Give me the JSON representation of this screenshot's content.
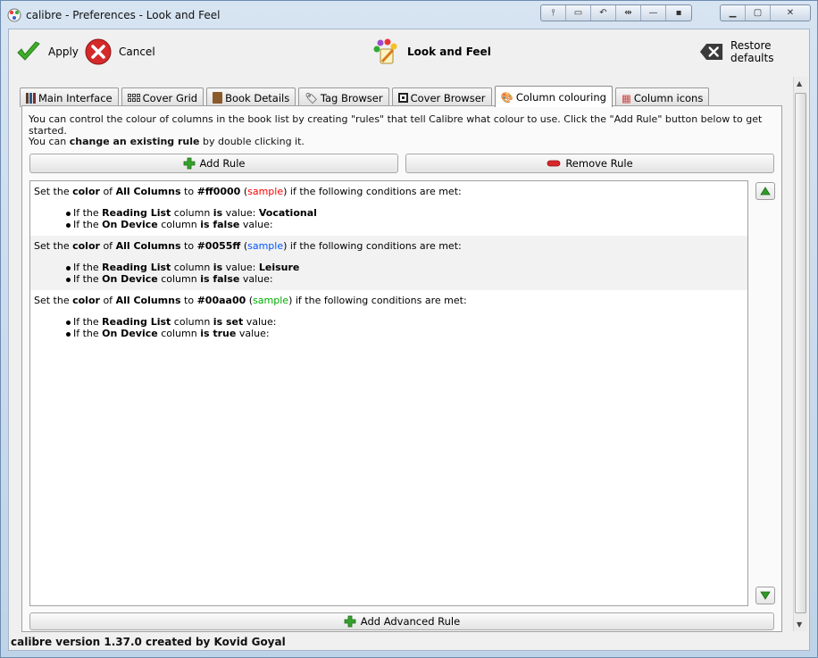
{
  "window": {
    "title": "calibre - Preferences - Look and Feel"
  },
  "toolbar": {
    "apply_label": "Apply",
    "cancel_label": "Cancel",
    "section_title": "Look and Feel",
    "restore_label": "Restore defaults"
  },
  "tabs": [
    {
      "label": "Main Interface",
      "icon": "books-icon"
    },
    {
      "label": "Cover Grid",
      "icon": "grid-icon"
    },
    {
      "label": "Book Details",
      "icon": "book-icon"
    },
    {
      "label": "Tag Browser",
      "icon": "tag-icon"
    },
    {
      "label": "Cover Browser",
      "icon": "cover-icon"
    },
    {
      "label": "Column colouring",
      "icon": "palette-icon",
      "active": true
    },
    {
      "label": "Column icons",
      "icon": "column-icons-icon"
    }
  ],
  "panel": {
    "intro_line1": "You can control the colour of columns in the book list by creating \"rules\" that tell Calibre what colour to use. Click the \"Add Rule\" button below to get started.",
    "intro_line2_prefix": "You can ",
    "intro_line2_bold": "change an existing rule",
    "intro_line2_suffix": " by double clicking it.",
    "add_rule_label": "Add Rule",
    "remove_rule_label": "Remove Rule",
    "add_advanced_label": "Add Advanced Rule"
  },
  "rules": [
    {
      "set": "Set the ",
      "color_word": "color",
      "of": " of ",
      "columns": "All Columns",
      "to": " to ",
      "value": "#ff0000",
      "sample": "sample",
      "sample_color": "#ff0000",
      "tail": " if the following conditions are met:",
      "conditions": [
        {
          "p1": "If the ",
          "col": "Reading List",
          "p2": " column ",
          "op": "is",
          "p3": " value: ",
          "val": "Vocational"
        },
        {
          "p1": "If the ",
          "col": "On Device",
          "p2": " column ",
          "op": "is false",
          "p3": " value:",
          "val": ""
        }
      ]
    },
    {
      "set": "Set the ",
      "color_word": "color",
      "of": " of ",
      "columns": "All Columns",
      "to": " to ",
      "value": "#0055ff",
      "sample": "sample",
      "sample_color": "#0055ff",
      "tail": " if the following conditions are met:",
      "conditions": [
        {
          "p1": "If the ",
          "col": "Reading List",
          "p2": " column ",
          "op": "is",
          "p3": " value: ",
          "val": "Leisure"
        },
        {
          "p1": "If the ",
          "col": "On Device",
          "p2": " column ",
          "op": "is false",
          "p3": " value:",
          "val": ""
        }
      ]
    },
    {
      "set": "Set the ",
      "color_word": "color",
      "of": " of ",
      "columns": "All Columns",
      "to": " to ",
      "value": "#00aa00",
      "sample": "sample",
      "sample_color": "#00aa00",
      "tail": " if the following conditions are met:",
      "conditions": [
        {
          "p1": "If the ",
          "col": "Reading List",
          "p2": " column ",
          "op": "is set",
          "p3": " value:",
          "val": ""
        },
        {
          "p1": "If the ",
          "col": "On Device",
          "p2": " column ",
          "op": "is true",
          "p3": " value:",
          "val": ""
        }
      ]
    }
  ],
  "status": {
    "text": "calibre version 1.37.0 created by Kovid Goyal"
  },
  "colors": {
    "apply_green": "#3fae2a",
    "cancel_red": "#d42a2a",
    "add_green": "#35a32c",
    "remove_red": "#d9262b",
    "arrow_green": "#2e9a28"
  }
}
